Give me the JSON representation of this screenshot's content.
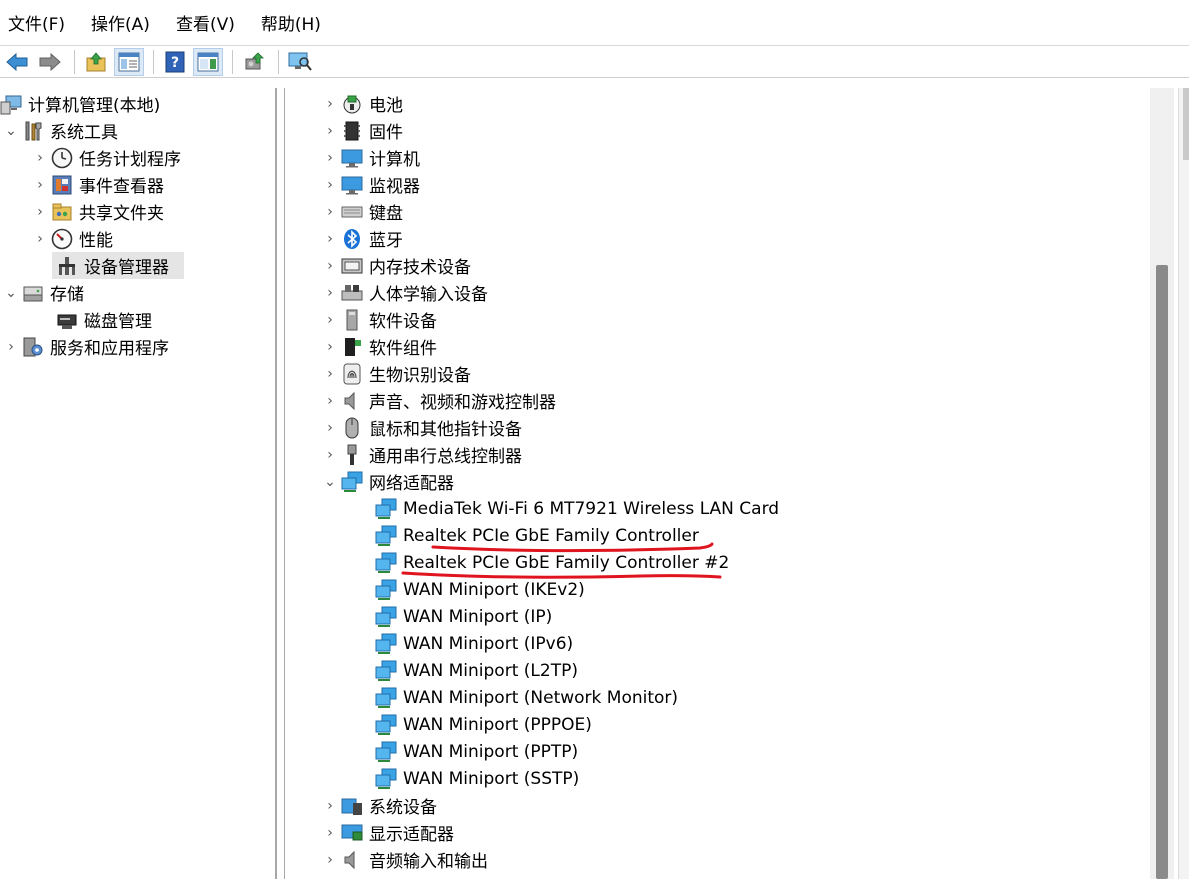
{
  "menubar": {
    "items": [
      "文件(F)",
      "操作(A)",
      "查看(V)",
      "帮助(H)"
    ]
  },
  "toolbar": {
    "buttons": [
      "back-icon",
      "forward-icon",
      "up-folder-icon",
      "show-hide-tree-icon",
      "help-icon",
      "properties-icon",
      "update-driver-icon",
      "scan-hardware-icon"
    ]
  },
  "left_tree": {
    "root": "计算机管理(本地)",
    "system_tools": "系统工具",
    "task_scheduler": "任务计划程序",
    "event_viewer": "事件查看器",
    "shared_folders": "共享文件夹",
    "performance": "性能",
    "device_manager": "设备管理器",
    "storage": "存储",
    "disk_management": "磁盘管理",
    "services_apps": "服务和应用程序"
  },
  "devices": {
    "categories_top": [
      "电池",
      "固件",
      "计算机",
      "监视器",
      "键盘",
      "蓝牙",
      "内存技术设备",
      "人体学输入设备",
      "软件设备",
      "软件组件",
      "生物识别设备",
      "声音、视频和游戏控制器",
      "鼠标和其他指针设备",
      "通用串行总线控制器"
    ],
    "network_adapters": "网络适配器",
    "adapters": [
      "MediaTek Wi-Fi 6 MT7921 Wireless LAN Card",
      "Realtek PCIe GbE Family Controller",
      "Realtek PCIe GbE Family Controller #2",
      "WAN Miniport (IKEv2)",
      "WAN Miniport (IP)",
      "WAN Miniport (IPv6)",
      "WAN Miniport (L2TP)",
      "WAN Miniport (Network Monitor)",
      "WAN Miniport (PPPOE)",
      "WAN Miniport (PPTP)",
      "WAN Miniport (SSTP)"
    ],
    "categories_bottom": [
      "系统设备",
      "显示适配器",
      "音频输入和输出"
    ]
  },
  "colors": {
    "annotation": "#e0141e",
    "selection": "#e5e5e5",
    "scroll_thumb": "#8a8a8a"
  }
}
